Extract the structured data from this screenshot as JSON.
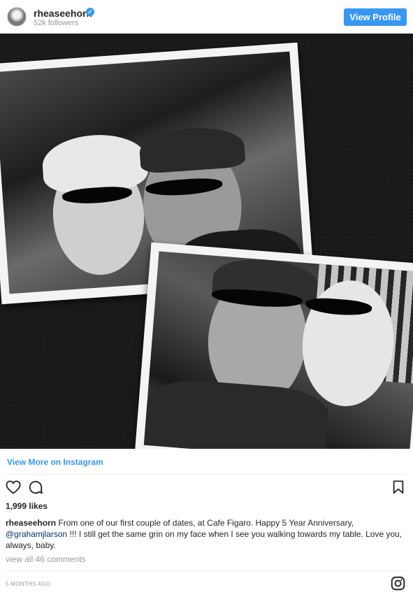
{
  "header": {
    "username": "rheaseehorn",
    "followers": "52k followers",
    "verified_glyph": "✓",
    "view_profile_label": "View Profile"
  },
  "post": {
    "view_more_label": "View More on Instagram",
    "likes": "1,999 likes",
    "caption_user": "rheaseehorn",
    "caption_part1": "From one of our first couple of dates, at Cafe Figaro. Happy 5 Year Anniversary,",
    "caption_mention": "@grahamjlarson",
    "caption_part2": "!!! I still get the same grin on my face when I see you walking towards my table. Love you, always, baby.",
    "comments_link": "view all 46 comments",
    "time_ago": "5 MONTHS AGO"
  },
  "icons": [
    "heart-icon",
    "comment-icon",
    "bookmark-icon",
    "instagram-logo-icon",
    "verified-badge-icon"
  ],
  "colors": {
    "accent": "#3897f0",
    "text": "#262626",
    "muted": "#999999",
    "mention": "#003569"
  }
}
